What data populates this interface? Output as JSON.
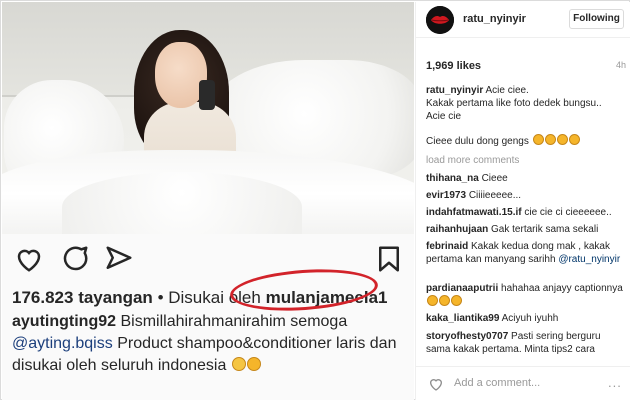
{
  "post": {
    "inner": {
      "views_count": "176.823",
      "views_label": "tayangan",
      "liked_by": "• Disukai oleh",
      "liked_user": "mulanjameela1",
      "caption_user": "ayutingting92",
      "caption_text": "Bismillahirahmanirahim semoga",
      "caption_mention": "@ayting.bqiss",
      "caption_rest": "Product shampoo&conditioner laris dan disukai oleh seluruh indonesia"
    }
  },
  "panel": {
    "username": "ratu_nyinyir",
    "follow_label": "Following",
    "likes": "1,969 likes",
    "time": "4h",
    "caption": {
      "user": "ratu_nyinyir",
      "line1": "Acie ciee.",
      "line2": "Kakak pertama like foto dedek bungsu..",
      "line3": "Acie cie"
    },
    "second_line": "Cieee dulu dong gengs",
    "load_more": "load more comments",
    "comments": [
      {
        "user": "thihana_na",
        "text": "Cieee"
      },
      {
        "user": "evir1973",
        "text": "Ciiiieeeee..."
      },
      {
        "user": "indahfatmawati.15.if",
        "text": "cie cie ci cieeeeee.."
      },
      {
        "user": "raihanhujaan",
        "text": "Gak tertarik sama sekali"
      },
      {
        "user": "febrinaid",
        "text": "Kakak kedua dong mak , kakak pertama kan manyang sarihh",
        "mention": "@ratu_nyinyir"
      },
      {
        "user": "pardianaaputrii",
        "text": "hahahaa anjayy captionnya"
      },
      {
        "user": "kaka_liantika99",
        "text": "Aciyuh iyuhh"
      },
      {
        "user": "storyofhesty0707",
        "text": "Pasti sering berguru sama kakak pertama. Minta tips2 cara"
      }
    ],
    "add_comment": "Add a comment...",
    "more_label": "..."
  },
  "icons": {
    "heart": "heart-icon",
    "comment": "comment-icon",
    "share": "send-icon",
    "bookmark": "bookmark-icon",
    "options": "more-options-icon"
  },
  "colors": {
    "highlight_oval": "#d2232a",
    "mention": "#003569",
    "muted": "#999999"
  }
}
